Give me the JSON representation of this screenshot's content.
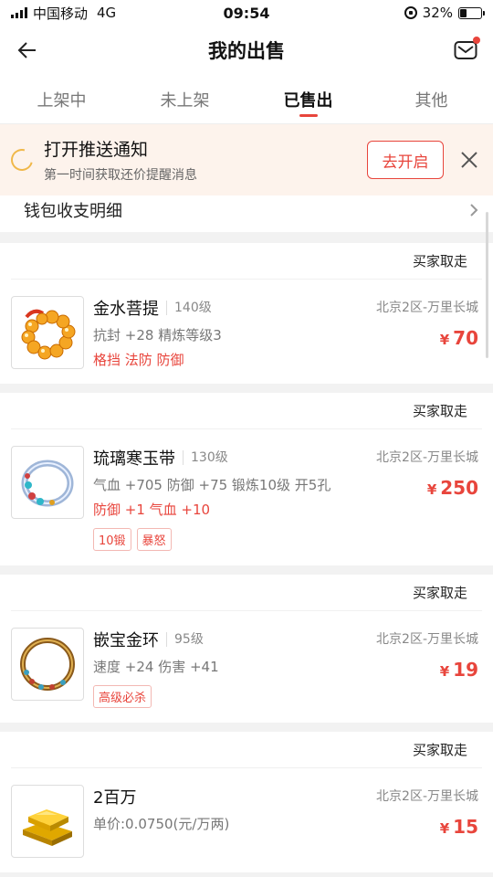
{
  "status_bar": {
    "carrier": "中国移动",
    "network": "4G",
    "time": "09:54",
    "battery": "32%",
    "battery_level": 0.32
  },
  "header": {
    "title": "我的出售"
  },
  "tabs": [
    {
      "label": "上架中",
      "active": false
    },
    {
      "label": "未上架",
      "active": false
    },
    {
      "label": "已售出",
      "active": true
    },
    {
      "label": "其他",
      "active": false
    }
  ],
  "notice": {
    "title": "打开推送通知",
    "subtitle": "第一时间获取还价提醒消息",
    "button": "去开启"
  },
  "wallet": {
    "label": "钱包收支明细"
  },
  "items": [
    {
      "status": "买家取走",
      "name": "金水菩提",
      "level": "140级",
      "server": "北京2区-万里长城",
      "stats": "抗封 +28 精炼等级3",
      "red_stats": "格挡 法防 防御",
      "tags": [],
      "currency": "¥",
      "price": "70",
      "icon": "beads-icon"
    },
    {
      "status": "买家取走",
      "name": "琉璃寒玉带",
      "level": "130级",
      "server": "北京2区-万里长城",
      "stats": "气血 +705 防御 +75 锻炼10级 开5孔",
      "red_stats": "防御 +1 气血 +10",
      "tags": [
        "10锻",
        "暴怒"
      ],
      "currency": "¥",
      "price": "250",
      "icon": "jade-belt-icon"
    },
    {
      "status": "买家取走",
      "name": "嵌宝金环",
      "level": "95级",
      "server": "北京2区-万里长城",
      "stats": "速度 +24 伤害 +41",
      "red_stats": "",
      "tags": [
        "高级必杀"
      ],
      "currency": "¥",
      "price": "19",
      "icon": "gold-ring-icon"
    },
    {
      "status": "买家取走",
      "name": "2百万",
      "level": "",
      "server": "北京2区-万里长城",
      "stats": "单价:0.0750(元/万两)",
      "red_stats": "",
      "tags": [],
      "currency": "¥",
      "price": "15",
      "icon": "gold-ingot-icon"
    }
  ]
}
